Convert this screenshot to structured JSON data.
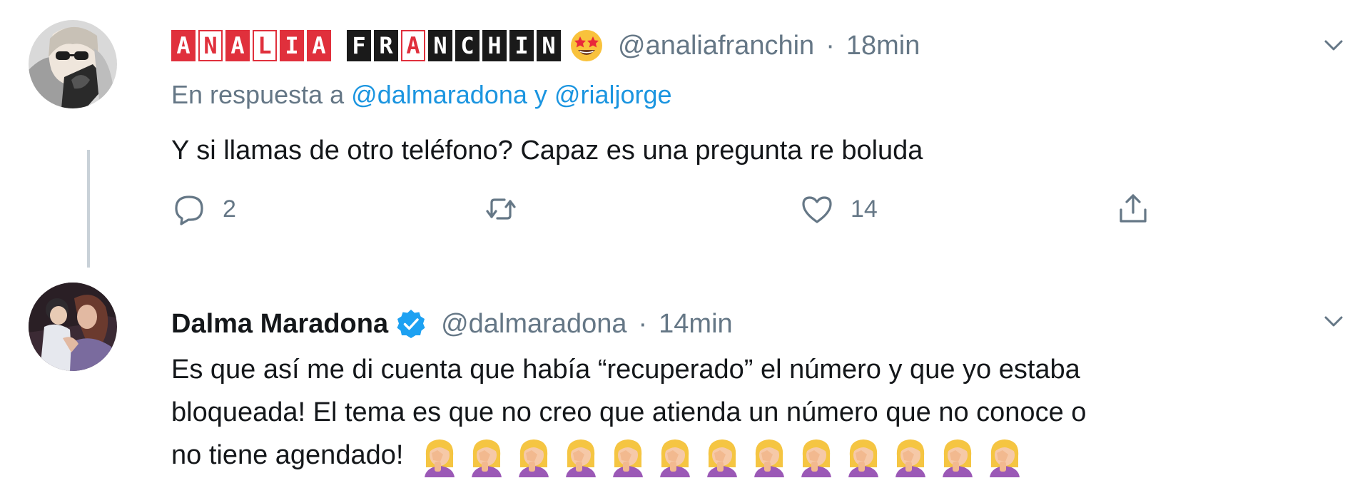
{
  "tweet1": {
    "name_tiles": [
      {
        "ch": "A",
        "style": "red"
      },
      {
        "ch": "N",
        "style": "white"
      },
      {
        "ch": "A",
        "style": "red"
      },
      {
        "ch": "L",
        "style": "white"
      },
      {
        "ch": "I",
        "style": "red"
      },
      {
        "ch": "A",
        "style": "red"
      },
      {
        "ch": "",
        "style": "gap"
      },
      {
        "ch": "F",
        "style": "dark"
      },
      {
        "ch": "R",
        "style": "dark"
      },
      {
        "ch": "A",
        "style": "dark acc"
      },
      {
        "ch": "N",
        "style": "dark"
      },
      {
        "ch": "C",
        "style": "dark"
      },
      {
        "ch": "H",
        "style": "dark"
      },
      {
        "ch": "I",
        "style": "dark"
      },
      {
        "ch": "N",
        "style": "dark"
      }
    ],
    "emoji": "star-struck",
    "handle": "@analiafranchin",
    "separator": "·",
    "time": "18min",
    "reply_prefix": "En respuesta a",
    "reply_mention_1": "@dalmaradona",
    "reply_conjunction": "y",
    "reply_mention_2": "@rialjorge",
    "text": "Y si llamas de otro teléfono? Capaz es una pregunta re boluda",
    "reply_count": "2",
    "retweet_count": "",
    "like_count": "14"
  },
  "tweet2": {
    "display_name": "Dalma Maradona",
    "handle": "@dalmaradona",
    "separator": "·",
    "time": "14min",
    "text_line1": "Es que así me di cuenta que había “recuperado” el número y que yo estaba",
    "text_line2": "bloqueada! El tema es que no creo que atienda un número que no conoce o",
    "text_line3": "no tiene agendado!",
    "facepalm_count": 13
  },
  "icons": {
    "reply": "reply-icon",
    "retweet": "retweet-icon",
    "like": "heart-icon",
    "share": "share-icon",
    "menu": "chevron-down-icon",
    "verified": "verified-badge-icon"
  },
  "colors": {
    "accent": "#1b95e0",
    "muted": "#657786",
    "verified": "#1da1f2",
    "tile_red": "#e0303c"
  }
}
